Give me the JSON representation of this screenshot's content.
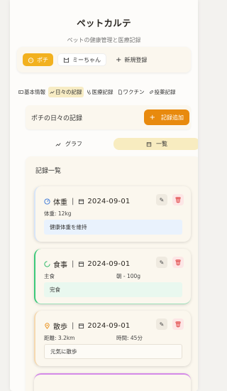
{
  "app": {
    "title": "ペットカルテ",
    "subtitle": "ペットの健康管理と医療記録"
  },
  "pets": {
    "items": [
      {
        "label": "ポチ"
      },
      {
        "label": "ミーちゃん"
      }
    ],
    "add_label": "新規登録"
  },
  "nav": {
    "tabs": [
      {
        "label": "基本情報",
        "icon": "id-card-icon"
      },
      {
        "label": "日々の記録",
        "icon": "trend-icon"
      },
      {
        "label": "医療記録",
        "icon": "stethoscope-icon"
      },
      {
        "label": "ワクチン",
        "icon": "document-icon"
      },
      {
        "label": "投薬記録",
        "icon": "pill-icon"
      }
    ],
    "active": 1
  },
  "records": {
    "title": "ポチの日々の記録",
    "add_button": "記録追加"
  },
  "view": {
    "graph_label": "グラフ",
    "list_label": "一覧"
  },
  "list": {
    "title": "記録一覧",
    "cards": [
      {
        "type": "体重",
        "date": "2024-09-01",
        "details": [
          "体重: 12kg"
        ],
        "note": "健康体重を維持",
        "accent": "#2f6fd6",
        "note_bg": "#e9f2fd"
      },
      {
        "type": "食事",
        "date": "2024-09-01",
        "details": [
          "主食",
          "朝 - 100g"
        ],
        "note": "完食",
        "accent": "#29b765",
        "note_bg": "#e9f8ef"
      },
      {
        "type": "散歩",
        "date": "2024-09-01",
        "details": [
          "距離: 3.2km",
          "時間: 45分"
        ],
        "note": "元気に散歩",
        "accent": "#e88a0e",
        "note_bg": "#fdfbf6"
      }
    ]
  },
  "colors": {
    "accent": "#f2b11f",
    "primary_button": "#e88a0e",
    "delete": "#d33333"
  }
}
